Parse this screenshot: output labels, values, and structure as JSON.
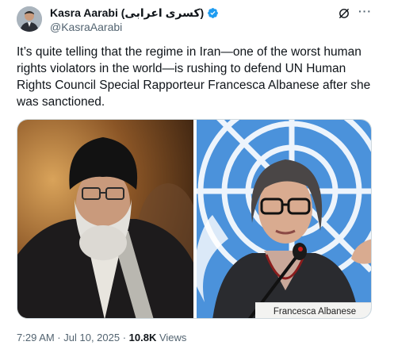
{
  "tweet": {
    "author_name": "Kasra Aarabi (کسری اعرابی)",
    "author_handle": "@KasraAarabi",
    "body": "It’s quite telling that the regime in Iran—one of the worst human rights violators in the world—is rushing to defend UN Human Rights Council Special Rapporteur Francesca Albanese after she was sanctioned.",
    "timestamp": "7:29 AM · Jul 10, 2025 · ",
    "views_count": "10.8K",
    "views_label": " Views",
    "nameplate_text": "Francesca Albanese"
  },
  "icons": {
    "verified": "verified-badge-icon",
    "grok": "grok-icon",
    "more": "more-icon"
  },
  "colors": {
    "verified_blue": "#1d9bf0",
    "secondary_text": "#536471",
    "un_blue": "#4b92db"
  }
}
